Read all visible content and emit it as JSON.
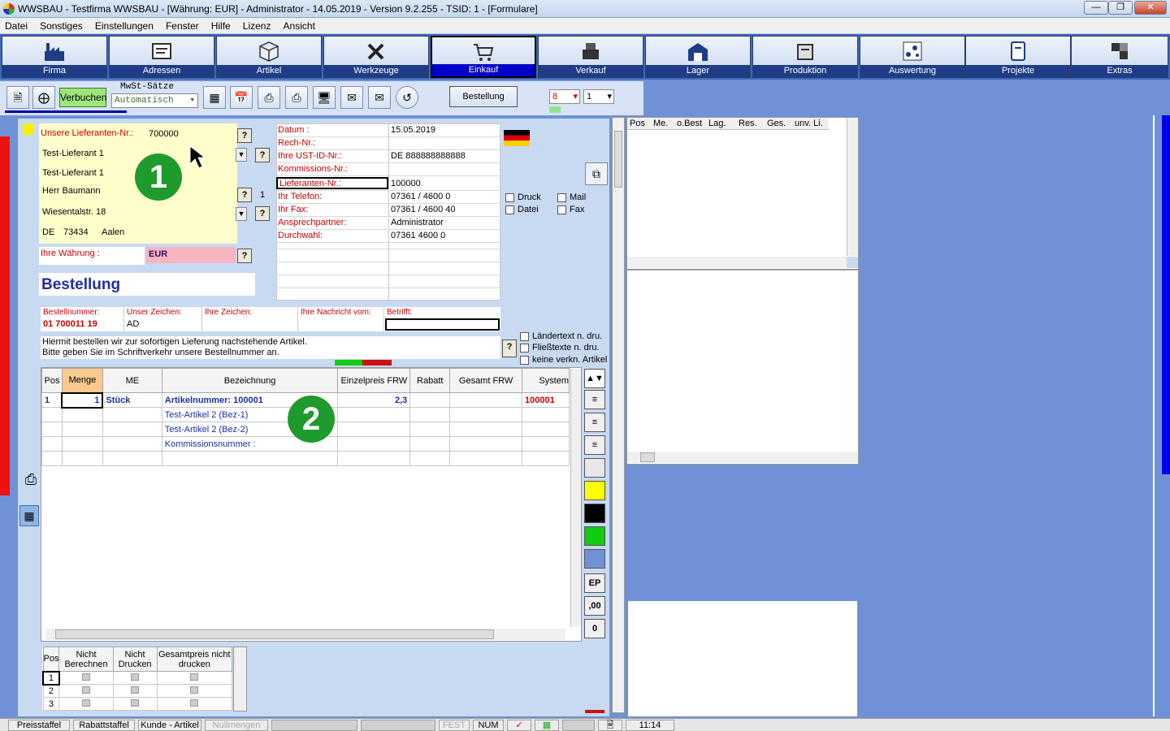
{
  "window": {
    "title": "WWSBAU - Testfirma WWSBAU - [Währung: EUR] - Administrator - 14.05.2019 - Version 9.2.255 - TSID: 1  - [Formulare]"
  },
  "menu": [
    "Datei",
    "Sonstiges",
    "Einstellungen",
    "Fenster",
    "Hilfe",
    "Lizenz",
    "Ansicht"
  ],
  "modules": [
    {
      "label": "Firma",
      "icon": "factory-icon"
    },
    {
      "label": "Adressen",
      "icon": "address-card-icon"
    },
    {
      "label": "Artikel",
      "icon": "box-icon"
    },
    {
      "label": "Werkzeuge",
      "icon": "tools-icon"
    },
    {
      "label": "Einkauf",
      "icon": "cart-icon",
      "active": true
    },
    {
      "label": "Verkauf",
      "icon": "register-icon"
    },
    {
      "label": "Lager",
      "icon": "warehouse-icon"
    },
    {
      "label": "Produktion",
      "icon": "production-icon"
    },
    {
      "label": "Auswertung",
      "icon": "analysis-icon"
    },
    {
      "label": "Projekte",
      "icon": "project-icon"
    },
    {
      "label": "Extras",
      "icon": "extras-icon"
    }
  ],
  "toolbar": {
    "verbuchen": "Verbuchen",
    "mwst_label": "MwSt-Sätze",
    "mwst_value": "Automatisch",
    "bestellung_btn": "Bestellung",
    "select1": "8",
    "select2": "1"
  },
  "supplier": {
    "nr_label": "Unsere Lieferanten-Nr.:",
    "nr_value": "700000",
    "name1": "Test-Lieferant 1",
    "name2": "Test-Lieferant 1",
    "contact": "Herr Baumann",
    "contact_count": "1",
    "street": "Wiesentalstr. 18",
    "country": "DE",
    "zip": "73434",
    "city": "Aalen",
    "currency_label": "Ihre Währung :",
    "currency": "EUR"
  },
  "doc_title": "Bestellung",
  "info": {
    "rows": [
      {
        "label": "Datum :",
        "value": "15.05.2019"
      },
      {
        "label": "Rech-Nr.:",
        "value": ""
      },
      {
        "label": "Ihre UST-ID-Nr.:",
        "value": "DE 888888888888"
      },
      {
        "label": "Kommissions-Nr.:",
        "value": ""
      },
      {
        "label": "Lieferanten-Nr.:",
        "value": "100000"
      },
      {
        "label": "Ihr Telefon:",
        "value": "07361 / 4600 0"
      },
      {
        "label": "Ihr Fax:",
        "value": "07361 / 4600 40"
      },
      {
        "label": "Ansprechpartner:",
        "value": "Administrator"
      },
      {
        "label": "Durchwahl:",
        "value": "07361 4600 0"
      }
    ]
  },
  "output": {
    "druck": "Druck",
    "mail": "Mail",
    "datei": "Datei",
    "fax": "Fax"
  },
  "refs": {
    "headers": [
      "Bestellnummer:",
      "Unser Zeichen:",
      "Ihre Zeichen:",
      "Ihre Nachricht vom:",
      "Betrifft:"
    ],
    "values": [
      "01 700011 19",
      "AD",
      "",
      "",
      ""
    ]
  },
  "intro": {
    "line1": "Hiermit bestellen wir zur sofortigen Lieferung nachstehende Artikel.",
    "line2": "Bitte geben Sie im Schriftverkehr unsere Bestellnummer an."
  },
  "options": [
    "Ländertext  n. dru.",
    "Fließtexte n. dru.",
    "keine verkn. Artikel"
  ],
  "table": {
    "headers": [
      "Pos",
      "Menge",
      "ME",
      "Bezeichnung",
      "Einzelpreis FRW",
      "Rabatt",
      "Gesamt FRW",
      "System"
    ],
    "rows": [
      [
        "1",
        "1",
        "Stück",
        "Artikelnummer: 100001",
        "2,3",
        "",
        "",
        "100001"
      ],
      [
        "",
        "",
        "",
        "Test-Artikel 2  (Bez-1)",
        "",
        "",
        "",
        ""
      ],
      [
        "",
        "",
        "",
        "Test-Artikel 2  (Bez-2)",
        "",
        "",
        "",
        ""
      ],
      [
        "",
        "",
        "",
        "Kommissionsnummer :",
        "",
        "",
        "",
        ""
      ],
      [
        "",
        "",
        "",
        "",
        "",
        "",
        "",
        ""
      ]
    ]
  },
  "sidebuttons": [
    "EP",
    ",00",
    "0"
  ],
  "bottom_table": {
    "headers": [
      "Pos",
      "Nicht Berechnen",
      "Nicht Drucken",
      "Gesamtpreis nicht drucken"
    ],
    "rows": [
      "1",
      "2",
      "3"
    ]
  },
  "right_table": {
    "headers": [
      "Pos",
      "Me.",
      "o.Best",
      "Lag.",
      "Res.",
      "Ges.",
      "unv. Li."
    ]
  },
  "badges": [
    "1",
    "2"
  ],
  "status": [
    "Preisstaffel",
    "Rabattstaffel",
    "Kunde - Artikel",
    "Nullmengen",
    "",
    "",
    "FEST",
    "NUM",
    "",
    "",
    "",
    "",
    "11:14"
  ],
  "colors": {
    "accent": "#1e3d86",
    "active": "#0000c8",
    "badge": "#1f9a2c"
  }
}
